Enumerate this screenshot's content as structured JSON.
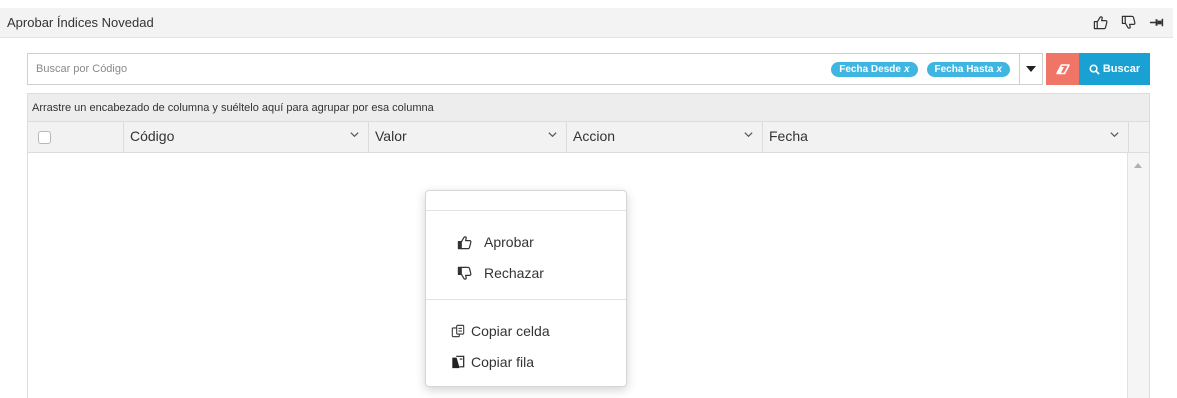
{
  "panel": {
    "title": "Aprobar Índices Novedad"
  },
  "search": {
    "placeholder": "Buscar por Código",
    "value": "",
    "chips": [
      {
        "label": "Fecha Desde",
        "remove": "x"
      },
      {
        "label": "Fecha Hasta",
        "remove": "x"
      }
    ],
    "search_button_label": "Buscar"
  },
  "grid": {
    "group_panel_text": "Arrastre un encabezado de columna y suéltelo aquí para agrupar por esa columna",
    "columns": [
      {
        "label": "Código"
      },
      {
        "label": "Valor"
      },
      {
        "label": "Accion"
      },
      {
        "label": "Fecha"
      }
    ],
    "rows": []
  },
  "context_menu": {
    "items": [
      {
        "label": "Aprobar",
        "icon": "thumbs-up-icon"
      },
      {
        "label": "Rechazar",
        "icon": "thumbs-down-icon"
      },
      {
        "label": "Copiar celda",
        "icon": "copy-cell-icon"
      },
      {
        "label": "Copiar fila",
        "icon": "copy-row-icon"
      }
    ]
  },
  "colors": {
    "chip": "#3fb5e2",
    "clear_button": "#f07566",
    "search_button": "#1aa1d4"
  }
}
